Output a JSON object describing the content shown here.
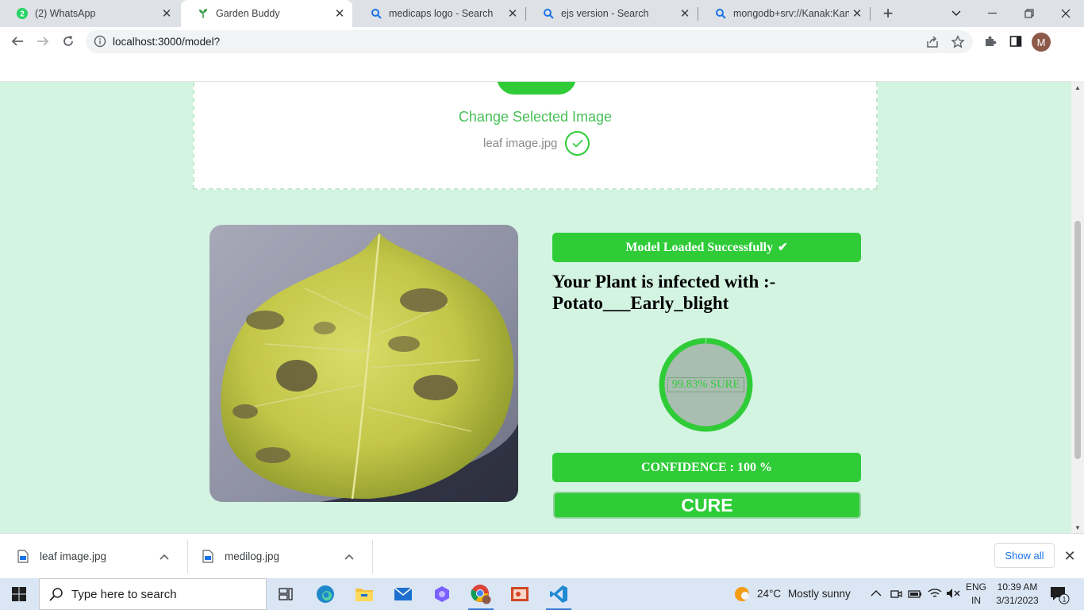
{
  "browser": {
    "tabs": [
      {
        "title": "(2) WhatsApp",
        "badge": "2",
        "icon": "whatsapp-icon"
      },
      {
        "title": "Garden Buddy",
        "icon": "plant-icon",
        "active": true
      },
      {
        "title": "medicaps logo - Search",
        "icon": "search-icon"
      },
      {
        "title": "ejs version - Search",
        "icon": "search-icon"
      },
      {
        "title": "mongodb+srv://Kanak:Kanak",
        "icon": "search-icon"
      }
    ],
    "url": "localhost:3000/model?",
    "profile_initial": "M"
  },
  "page": {
    "upload": {
      "change_label": "Change Selected Image",
      "file_name": "leaf image.jpg"
    },
    "status_label": "Model Loaded Successfully",
    "result_line1": "Your Plant is infected with :-",
    "result_line2": "Potato___Early_blight",
    "gauge": {
      "label": "99.83% SURE",
      "value": 99.83
    },
    "confidence_label": "CONFIDENCE : 100 %",
    "cure_label": "CURE",
    "colors": {
      "accent": "#2fcc38",
      "background": "#d4f4e2"
    }
  },
  "downloads": {
    "items": [
      {
        "name": "leaf image.jpg"
      },
      {
        "name": "medilog.jpg"
      }
    ],
    "show_all": "Show all"
  },
  "taskbar": {
    "search_placeholder": "Type here to search",
    "weather": {
      "temp": "24°C",
      "text": "Mostly sunny"
    },
    "lang": {
      "line1": "ENG",
      "line2": "IN"
    },
    "time": "10:39 AM",
    "date": "3/31/2023",
    "notification_count": "1"
  }
}
